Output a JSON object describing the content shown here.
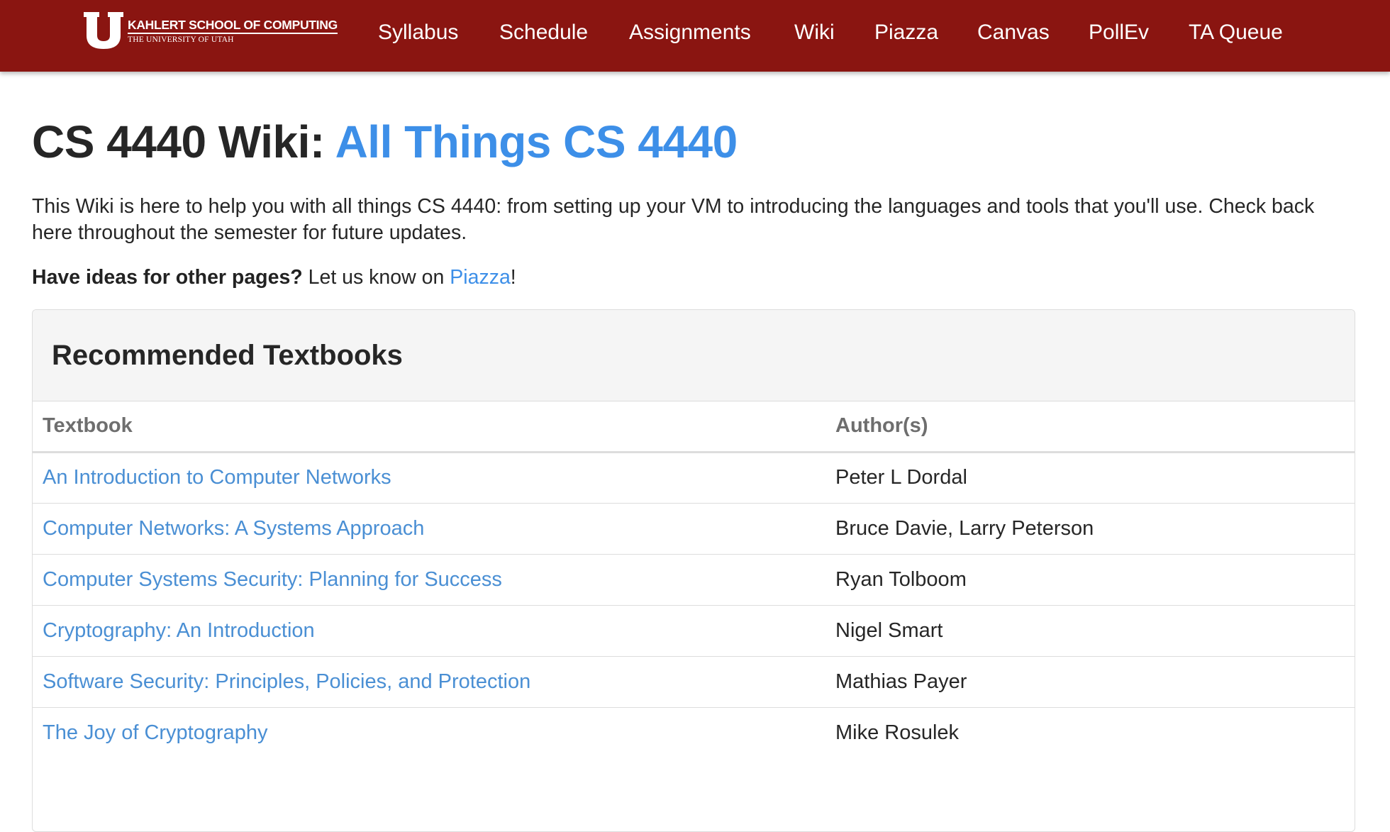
{
  "navbar": {
    "brand": {
      "logo_letter": "U",
      "line1": "KAHLERT SCHOOL OF COMPUTING",
      "line2": "THE UNIVERSITY OF UTAH"
    },
    "links": [
      "Syllabus",
      "Schedule",
      "Assignments",
      "Wiki",
      "Piazza",
      "Canvas",
      "PollEv",
      "TA Queue"
    ]
  },
  "page": {
    "title_prefix": "CS 4440 Wiki:",
    "title_accent": "All Things CS 4440",
    "intro": "This Wiki is here to help you with all things CS 4440: from setting up your VM to introducing the languages and tools that you'll use. Check back here throughout the semester for future updates.",
    "ideas": {
      "bold": "Have ideas for other pages?",
      "text": " Let us know on ",
      "link": "Piazza",
      "end": "!"
    }
  },
  "textbooks": {
    "heading": "Recommended Textbooks",
    "columns": [
      "Textbook",
      "Author(s)"
    ],
    "rows": [
      {
        "title": "An Introduction to Computer Networks",
        "authors": "Peter L Dordal"
      },
      {
        "title": "Computer Networks: A Systems Approach",
        "authors": "Bruce Davie, Larry Peterson"
      },
      {
        "title": "Computer Systems Security: Planning for Success",
        "authors": "Ryan Tolboom"
      },
      {
        "title": "Cryptography: An Introduction",
        "authors": "Nigel Smart"
      },
      {
        "title": "Software Security: Principles, Policies, and Protection",
        "authors": "Mathias Payer"
      },
      {
        "title": "The Joy of Cryptography",
        "authors": "Mike Rosulek"
      }
    ]
  },
  "colors": {
    "navbar_bg": "#8a1511",
    "accent_blue": "#3d8fe8",
    "link_blue": "#4a8fd4",
    "panel_heading_bg": "#f5f5f5"
  }
}
